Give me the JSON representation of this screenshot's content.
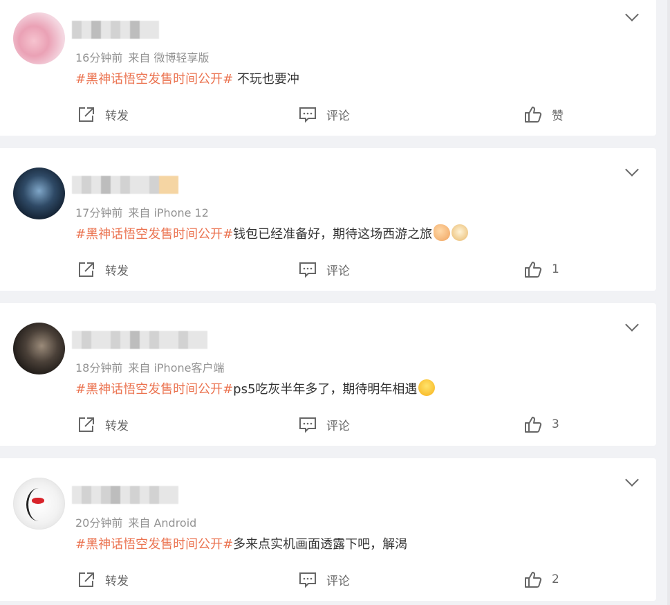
{
  "posts": [
    {
      "time": "16分钟前",
      "source": "来自 微博轻享版",
      "topic": "#黑神话悟空发售时间公开#",
      "text": " 不玩也要冲",
      "emojis": [],
      "forward_label": "转发",
      "comment_label": "评论",
      "like_label": "赞"
    },
    {
      "time": "17分钟前",
      "source": "来自 iPhone 12",
      "topic": "#黑神话悟空发售时间公开#",
      "text": "钱包已经准备好，期待这场西游之旅",
      "emojis": [
        "muscle-emoji",
        "doge-emoji"
      ],
      "forward_label": "转发",
      "comment_label": "评论",
      "like_label": "1"
    },
    {
      "time": "18分钟前",
      "source": "来自 iPhone客户端",
      "topic": "#黑神话悟空发售时间公开#",
      "text": "ps5吃灰半年多了，期待明年相遇",
      "emojis": [
        "shocked-emoji"
      ],
      "forward_label": "转发",
      "comment_label": "评论",
      "like_label": "3"
    },
    {
      "time": "20分钟前",
      "source": "来自 Android",
      "topic": "#黑神话悟空发售时间公开#",
      "text": "多来点实机画面透露下吧，解渴",
      "emojis": [],
      "forward_label": "转发",
      "comment_label": "评论",
      "like_label": "2"
    }
  ],
  "colors": {
    "topic": "#eb7350",
    "meta": "#939393",
    "background": "#f1f2f5"
  }
}
